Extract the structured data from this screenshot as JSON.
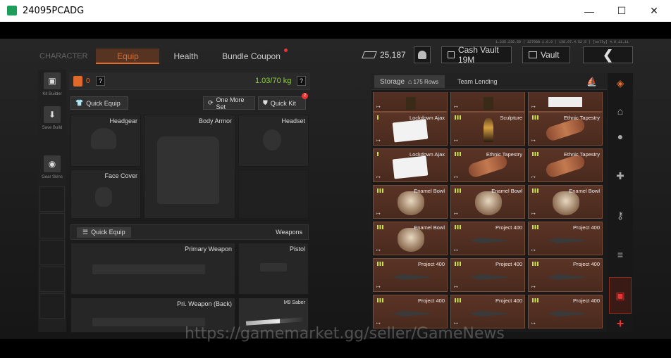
{
  "window": {
    "title": "24095PCADG",
    "minimize": "—",
    "maximize": "☐",
    "close": "✕"
  },
  "top_info": "1.235.236.59 | 327080.1.6.0 | 138.07.4.52.5 | [solly] 4.0.11.11",
  "tabs": {
    "character": "CHARACTER",
    "equip": "Equip",
    "health": "Health",
    "bundle": "Bundle Coupon"
  },
  "currency": {
    "amount": "25,187"
  },
  "cash_vault": "Cash Vault 19M",
  "vault": "Vault",
  "left_rail": {
    "kit_builder": "Kit Builder",
    "save_build": "Save Build",
    "gear_skins": "Gear Skins"
  },
  "equip": {
    "badge": "0",
    "help": "?",
    "weight": "1.03/70 kg",
    "quick_equip": "Quick Equip",
    "one_more_set": "One More Set",
    "quick_kit": "Quick Kit",
    "quick_kit_badge": "2",
    "slots": {
      "headgear": "Headgear",
      "body_armor": "Body Armor",
      "headset": "Headset",
      "face_cover": "Face Cover"
    },
    "weapons_section": "Weapons",
    "quick_equip2": "Quick Equip",
    "weapon_slots": {
      "primary": "Primary Weapon",
      "pistol": "Pistol",
      "back": "Pri. Weapon (Back)",
      "melee": "M9 Saber"
    }
  },
  "storage": {
    "tab": "Storage",
    "rows": "175 Rows",
    "team": "Team Lending",
    "items": [
      [
        "",
        "",
        ""
      ],
      [
        "Lockdown Ajax",
        "Sculpture",
        "Ethnic Tapestry"
      ],
      [
        "Lockdown Ajax",
        "Ethnic Tapestry",
        "Ethnic Tapestry"
      ],
      [
        "Enamel Bowl",
        "Enamel Bowl",
        "Enamel Bowl"
      ],
      [
        "Enamel Bowl",
        "Project 400",
        "Project 400"
      ],
      [
        "Project 400",
        "Project 400",
        "Project 400"
      ],
      [
        "Project 400",
        "Project 400",
        "Project 400"
      ]
    ]
  },
  "watermark": "https://gamemarket.gg/seller/GameNews"
}
